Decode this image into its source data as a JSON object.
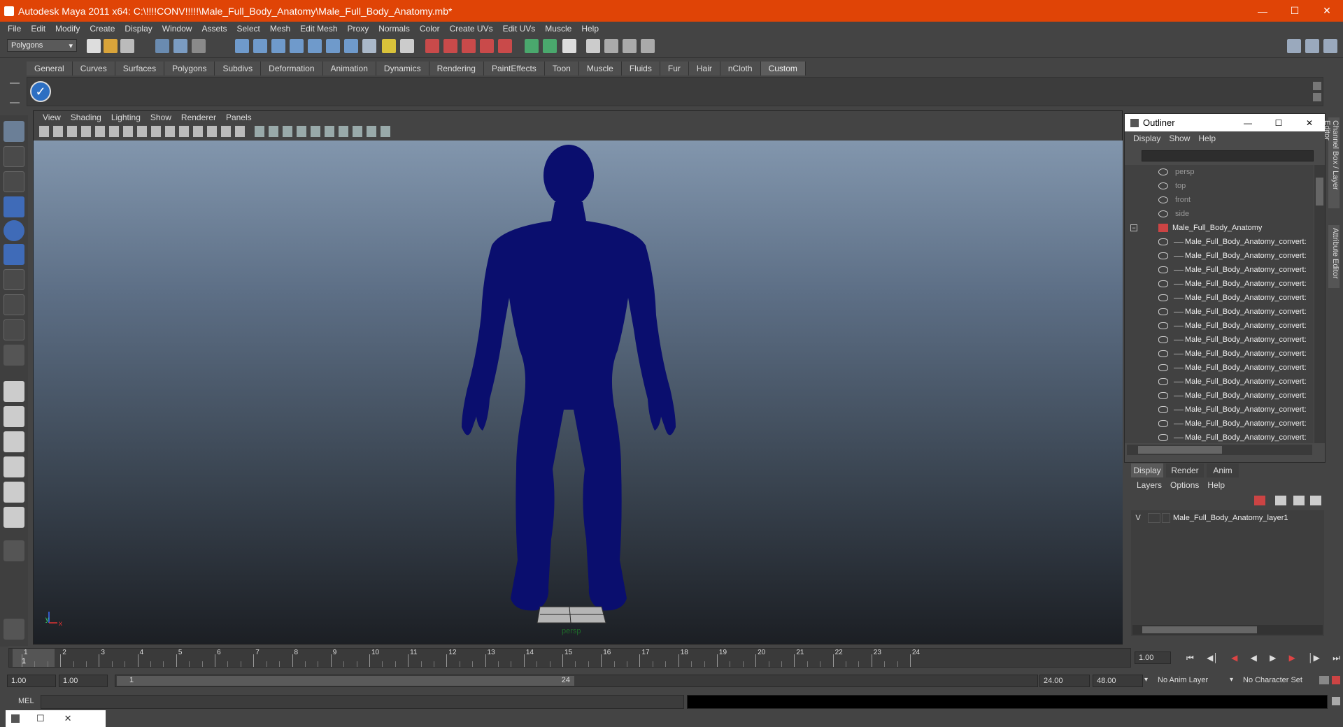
{
  "window": {
    "title": "Autodesk Maya 2011 x64: C:\\!!!!CONV!!!!!\\Male_Full_Body_Anatomy\\Male_Full_Body_Anatomy.mb*"
  },
  "menus": [
    "File",
    "Edit",
    "Modify",
    "Create",
    "Display",
    "Window",
    "Assets",
    "Select",
    "Mesh",
    "Edit Mesh",
    "Proxy",
    "Normals",
    "Color",
    "Create UVs",
    "Edit UVs",
    "Muscle",
    "Help"
  ],
  "menu_set": "Polygons",
  "shelf_tabs": [
    "General",
    "Curves",
    "Surfaces",
    "Polygons",
    "Subdivs",
    "Deformation",
    "Animation",
    "Dynamics",
    "Rendering",
    "PaintEffects",
    "Toon",
    "Muscle",
    "Fluids",
    "Fur",
    "Hair",
    "nCloth",
    "Custom"
  ],
  "active_shelf_tab": "Custom",
  "panel_menus": [
    "View",
    "Shading",
    "Lighting",
    "Show",
    "Renderer",
    "Panels"
  ],
  "viewport": {
    "camera_label": "persp",
    "axis_y": "y",
    "axis_x": "x",
    "model_color": "#0a0e6e"
  },
  "outliner": {
    "title": "Outliner",
    "menus": [
      "Display",
      "Show",
      "Help"
    ],
    "cameras": [
      "persp",
      "top",
      "front",
      "side"
    ],
    "group": "Male_Full_Body_Anatomy",
    "children": [
      "Male_Full_Body_Anatomy_convert:",
      "Male_Full_Body_Anatomy_convert:",
      "Male_Full_Body_Anatomy_convert:",
      "Male_Full_Body_Anatomy_convert:",
      "Male_Full_Body_Anatomy_convert:",
      "Male_Full_Body_Anatomy_convert:",
      "Male_Full_Body_Anatomy_convert:",
      "Male_Full_Body_Anatomy_convert:",
      "Male_Full_Body_Anatomy_convert:",
      "Male_Full_Body_Anatomy_convert:",
      "Male_Full_Body_Anatomy_convert:",
      "Male_Full_Body_Anatomy_convert:",
      "Male_Full_Body_Anatomy_convert:",
      "Male_Full_Body_Anatomy_convert:",
      "Male_Full_Body_Anatomy_convert:"
    ]
  },
  "layer_editor": {
    "tabs": [
      "Display",
      "Render",
      "Anim"
    ],
    "active_tab": "Display",
    "menus": [
      "Layers",
      "Options",
      "Help"
    ],
    "layer_visible": "V",
    "layer_name": "Male_Full_Body_Anatomy_layer1"
  },
  "side_tabs": [
    "Channel Box / Layer Editor",
    "Attribute Editor"
  ],
  "timeline": {
    "ticks": [
      "1",
      "2",
      "3",
      "4",
      "5",
      "6",
      "7",
      "8",
      "9",
      "10",
      "11",
      "12",
      "13",
      "14",
      "15",
      "16",
      "17",
      "18",
      "19",
      "20",
      "21",
      "22",
      "23",
      "24"
    ],
    "current_frame": "1",
    "current_time_field": "1.00"
  },
  "range": {
    "start_time": "1.00",
    "playback_start": "1.00",
    "range_start_label": "1",
    "range_end_label": "24",
    "playback_end": "24.00",
    "end_time": "48.00",
    "anim_layer": "No Anim Layer",
    "character_set": "No Character Set"
  },
  "command_line": {
    "label": "MEL"
  }
}
